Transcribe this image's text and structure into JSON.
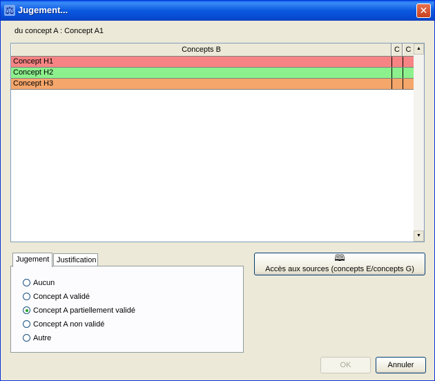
{
  "window": {
    "title": "Jugement...",
    "icon": "scales-icon",
    "close_glyph": "✕"
  },
  "concept_a_label": "du concept A : Concept A1",
  "table": {
    "columns": [
      "Concepts B",
      "C",
      "C"
    ],
    "rows": [
      {
        "name": "Concept H1",
        "color": "#f78484"
      },
      {
        "name": "Concept H2",
        "color": "#8cf08c"
      },
      {
        "name": "Concept H3",
        "color": "#f5a66b"
      }
    ],
    "scroll_up": "▲",
    "scroll_down": "▼"
  },
  "tabs": [
    {
      "label": "Jugement",
      "active": true
    },
    {
      "label": "Justification",
      "active": false
    }
  ],
  "radio_options": [
    {
      "label": "Aucun",
      "checked": false
    },
    {
      "label": "Concept A validé",
      "checked": false
    },
    {
      "label": "Concept A partiellement validé",
      "checked": true
    },
    {
      "label": "Concept A non validé",
      "checked": false
    },
    {
      "label": "Autre",
      "checked": false
    }
  ],
  "sources_button": {
    "icon": "open-book-icon",
    "glyph": "🕮",
    "label": "Accès aux sources (concepts E/concepts G)"
  },
  "ok_button": {
    "label": "OK",
    "enabled": false
  },
  "cancel_button": {
    "label": "Annuler",
    "enabled": true
  }
}
